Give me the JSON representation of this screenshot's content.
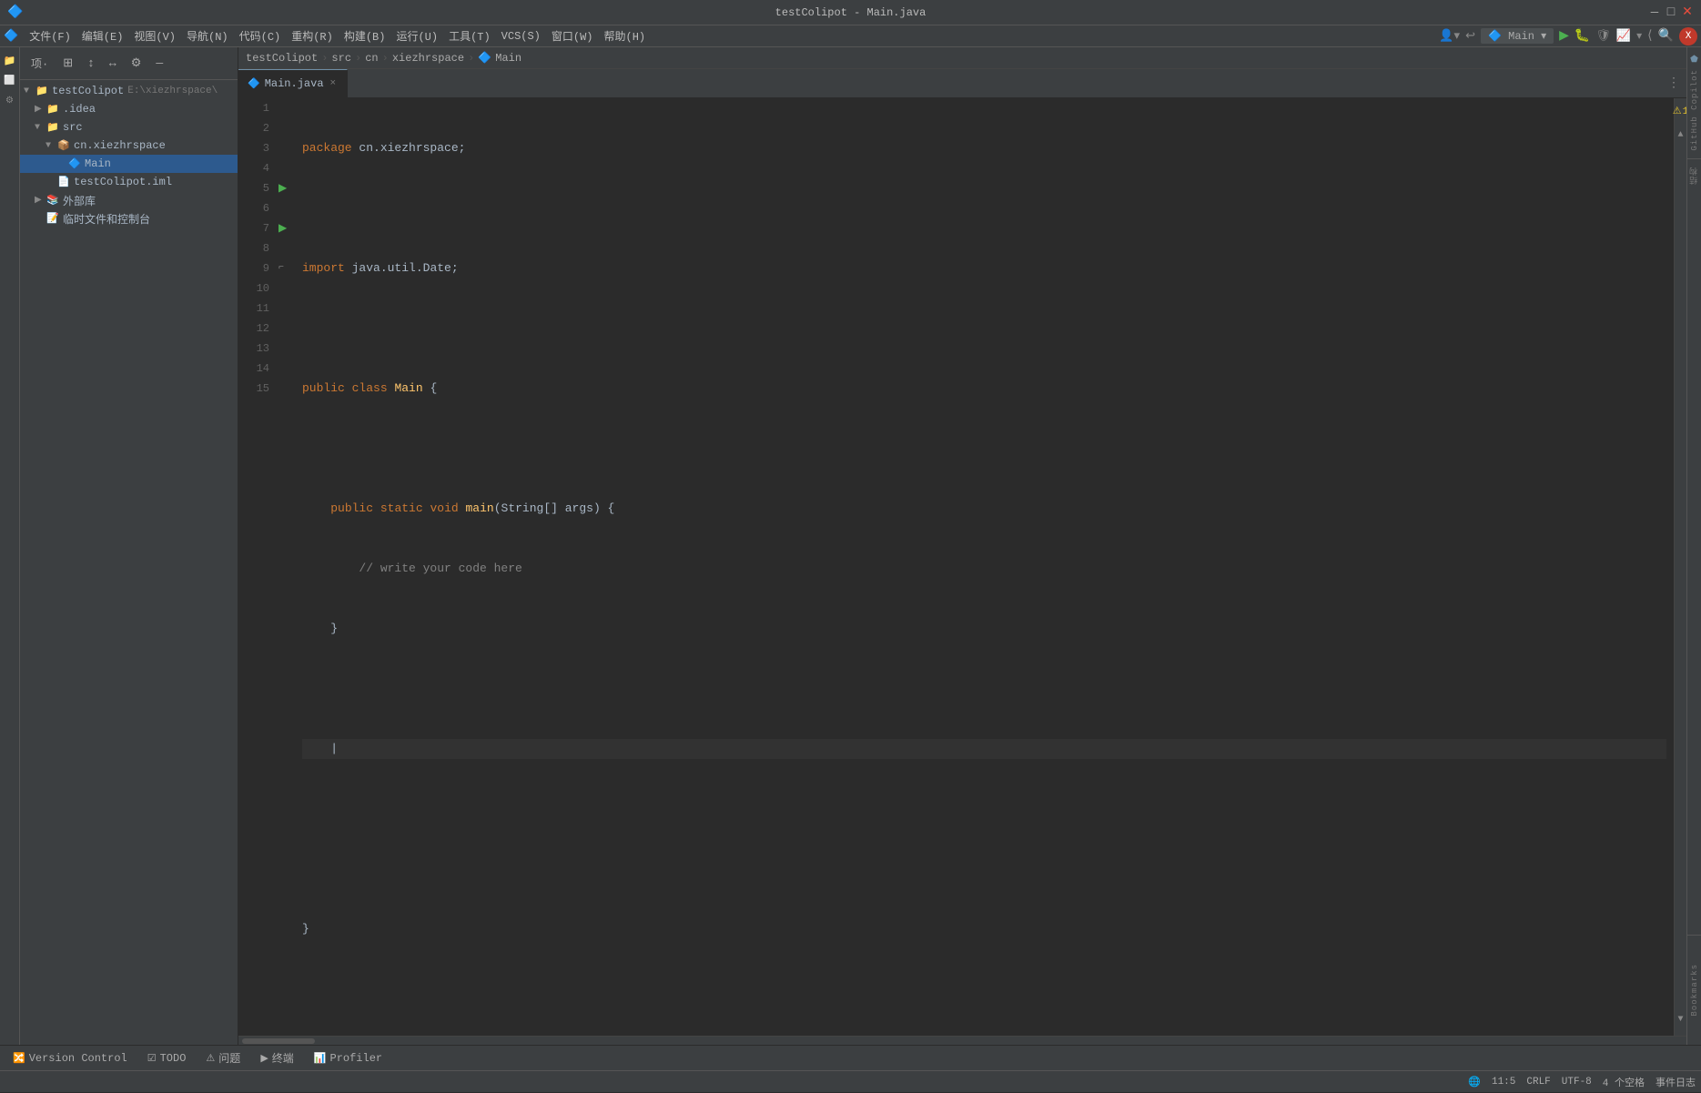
{
  "titleBar": {
    "appName": "testColipot - Main.java",
    "menus": [
      "文件(F)",
      "编辑(E)",
      "视图(V)",
      "导航(N)",
      "代码(C)",
      "重构(R)",
      "构建(B)",
      "运行(U)",
      "工具(T)",
      "VCS(S)",
      "窗口(W)",
      "帮助(H)"
    ],
    "logo": "🔷",
    "controls": [
      "—",
      "□",
      "×"
    ]
  },
  "breadcrumb": {
    "items": [
      "testColipot",
      "src",
      "cn",
      "xiezhrspace",
      "Main"
    ]
  },
  "toolbar": {
    "projectLabel": "项·",
    "buttons": [
      "⊞",
      "↕",
      "↔",
      "⚙",
      "—"
    ]
  },
  "projectTree": {
    "root": "testColipot",
    "rootPath": "E:\\xiezhrspace\\",
    "items": [
      {
        "id": "idea",
        "label": ".idea",
        "indent": 1,
        "type": "folder",
        "expanded": false
      },
      {
        "id": "src",
        "label": "src",
        "indent": 1,
        "type": "folder",
        "expanded": true
      },
      {
        "id": "cn-xiezhrspace",
        "label": "cn.xiezhrspace",
        "indent": 2,
        "type": "package",
        "expanded": true
      },
      {
        "id": "Main",
        "label": "Main",
        "indent": 3,
        "type": "class",
        "selected": true
      },
      {
        "id": "testColipot-iml",
        "label": "testColipot.iml",
        "indent": 2,
        "type": "config"
      },
      {
        "id": "external-libs",
        "label": "外部库",
        "indent": 1,
        "type": "folder",
        "expanded": false
      },
      {
        "id": "scratch",
        "label": "临时文件和控制台",
        "indent": 1,
        "type": "scratch"
      }
    ]
  },
  "tabs": [
    {
      "id": "main-java",
      "label": "Main.java",
      "active": true,
      "icon": "🔷",
      "closable": true
    }
  ],
  "editor": {
    "warningCount": "1",
    "lines": [
      {
        "num": 1,
        "code": "package cn.xiezhrspace;",
        "tokens": [
          {
            "t": "kw",
            "v": "package"
          },
          {
            "t": "",
            "v": " cn.xiezhrspace;"
          }
        ]
      },
      {
        "num": 2,
        "code": "",
        "tokens": []
      },
      {
        "num": 3,
        "code": "import java.util.Date;",
        "tokens": [
          {
            "t": "kw",
            "v": "import"
          },
          {
            "t": "",
            "v": " java.util.Date;"
          }
        ]
      },
      {
        "num": 4,
        "code": "",
        "tokens": []
      },
      {
        "num": 5,
        "code": "public class Main {",
        "tokens": [
          {
            "t": "kw",
            "v": "public"
          },
          {
            "t": "",
            "v": " "
          },
          {
            "t": "kw",
            "v": "class"
          },
          {
            "t": "",
            "v": " "
          },
          {
            "t": "cls",
            "v": "Main"
          },
          {
            "t": "",
            "v": " {"
          }
        ]
      },
      {
        "num": 6,
        "code": "",
        "tokens": []
      },
      {
        "num": 7,
        "code": "    public static void main(String[] args) {",
        "tokens": [
          {
            "t": "",
            "v": "    "
          },
          {
            "t": "kw",
            "v": "public"
          },
          {
            "t": "",
            "v": " "
          },
          {
            "t": "kw",
            "v": "static"
          },
          {
            "t": "",
            "v": " "
          },
          {
            "t": "kw",
            "v": "void"
          },
          {
            "t": "",
            "v": " "
          },
          {
            "t": "fn",
            "v": "main"
          },
          {
            "t": "",
            "v": "("
          },
          {
            "t": "type",
            "v": "String"
          },
          {
            "t": "",
            "v": "[] args) {"
          }
        ]
      },
      {
        "num": 8,
        "code": "        // write your code here",
        "tokens": [
          {
            "t": "cmt",
            "v": "        // write your code here"
          }
        ]
      },
      {
        "num": 9,
        "code": "    }",
        "tokens": [
          {
            "t": "",
            "v": "    }"
          }
        ]
      },
      {
        "num": 10,
        "code": "",
        "tokens": []
      },
      {
        "num": 11,
        "code": "",
        "tokens": [],
        "current": true
      },
      {
        "num": 12,
        "code": "",
        "tokens": []
      },
      {
        "num": 13,
        "code": "",
        "tokens": []
      },
      {
        "num": 14,
        "code": "}",
        "tokens": [
          {
            "t": "",
            "v": "}"
          }
        ]
      },
      {
        "num": 15,
        "code": "",
        "tokens": []
      }
    ],
    "gutterIcons": [
      {
        "line": 5,
        "type": "run"
      },
      {
        "line": 7,
        "type": "run"
      }
    ]
  },
  "bottomTabs": [
    {
      "id": "version-control",
      "label": "Version Control",
      "icon": "🔀"
    },
    {
      "id": "todo",
      "label": "TODO",
      "icon": "☑"
    },
    {
      "id": "problems",
      "label": "问题",
      "icon": "⚠"
    },
    {
      "id": "terminal",
      "label": "终端",
      "icon": "▶"
    },
    {
      "id": "profiler",
      "label": "Profiler",
      "icon": "📊"
    }
  ],
  "statusBar": {
    "left": [],
    "right": [
      {
        "id": "internet",
        "label": "🌐",
        "tooltip": "internet"
      },
      {
        "id": "position",
        "label": "11:5"
      },
      {
        "id": "lineEnding",
        "label": "CRLF"
      },
      {
        "id": "encoding",
        "label": "UTF-8"
      },
      {
        "id": "indent",
        "label": "4 个空格"
      },
      {
        "id": "eventLog",
        "label": "事件日志"
      }
    ]
  },
  "rightSidePanels": {
    "copilot": "GitHub Copilot",
    "structure": "结构",
    "bookmarks": "Bookmarks"
  }
}
